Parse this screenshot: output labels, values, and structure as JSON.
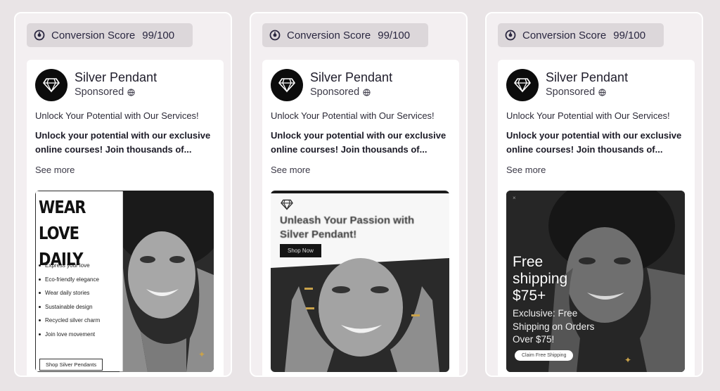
{
  "cards": [
    {
      "score_label": "Conversion Score",
      "score_value": "99/100",
      "brand": "Silver Pendant",
      "sponsored": "Sponsored",
      "headline": "Unlock Your Potential with Our Services!",
      "body": "Unlock your potential with our exclusive online courses! Join thousands of...",
      "see_more": "See more",
      "creative": {
        "title_line1": "WEAR LOVE",
        "title_line2": "DAILY",
        "bullets": [
          "Express your love",
          "Eco-friendly elegance",
          "Wear daily stories",
          "Sustainable design",
          "Recycled silver charm",
          "Join love movement"
        ],
        "cta": "Shop Silver Pendants"
      }
    },
    {
      "score_label": "Conversion Score",
      "score_value": "99/100",
      "brand": "Silver Pendant",
      "sponsored": "Sponsored",
      "headline": "Unlock Your Potential with Our Services!",
      "body": "Unlock your potential with our exclusive online courses! Join thousands of...",
      "see_more": "See more",
      "creative": {
        "heading": "Unleash Your Passion with Silver Pendant!",
        "cta": "Shop Now"
      }
    },
    {
      "score_label": "Conversion Score",
      "score_value": "99/100",
      "brand": "Silver Pendant",
      "sponsored": "Sponsored",
      "headline": "Unlock Your Potential with Our Services!",
      "body": "Unlock your potential with our exclusive online courses! Join thousands of...",
      "see_more": "See more",
      "creative": {
        "close": "×",
        "line1": "Free",
        "line2": "shipping",
        "line3": "$75+",
        "sub": "Exclusive: Free Shipping on Orders Over $75!",
        "cta": "Claim Free Shipping"
      }
    }
  ],
  "icons": {
    "score": "gauge-icon",
    "logo": "diamond-icon",
    "sponsored": "globe-icon"
  },
  "colors": {
    "background": "#e9e4e6",
    "card": "#f3eff1",
    "score_pill": "#dcd7da",
    "logo_bg": "#0c0c0c"
  }
}
